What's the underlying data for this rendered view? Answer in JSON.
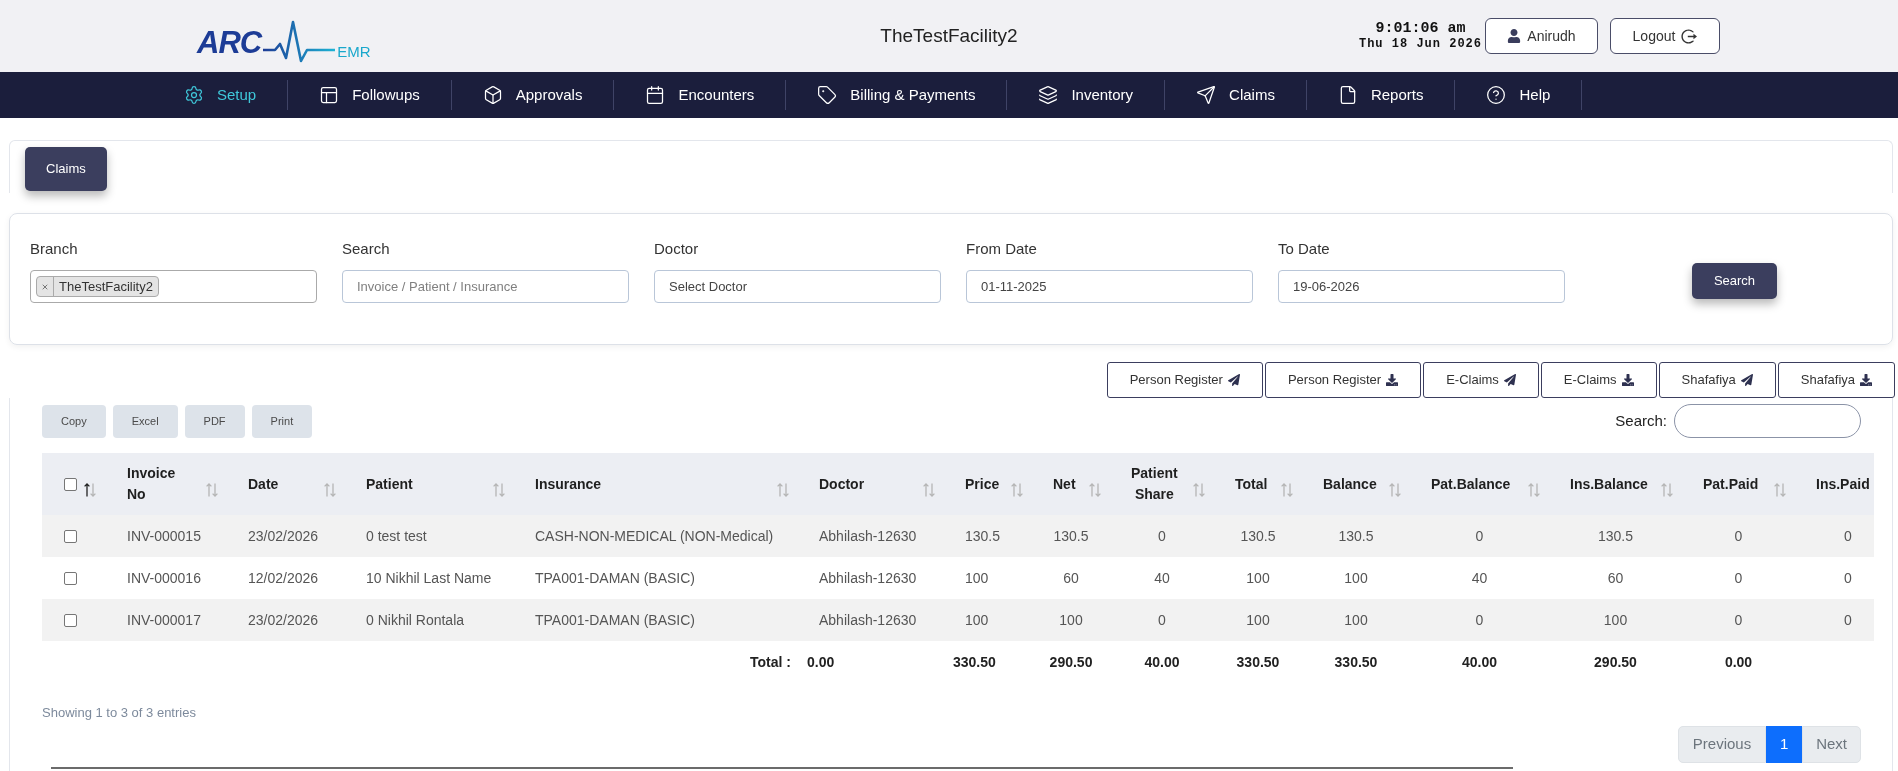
{
  "header": {
    "logo": {
      "brand": "ARC",
      "suffix": "EMR"
    },
    "title": "TheTestFacility2",
    "clock": {
      "time": "9:01:06 am",
      "date": "Thu 18 Jun 2026"
    },
    "user_button": "Anirudh",
    "logout_button": "Logout"
  },
  "nav": [
    {
      "label": "Setup",
      "selected": true
    },
    {
      "label": "Followups",
      "selected": false
    },
    {
      "label": "Approvals",
      "selected": false
    },
    {
      "label": "Encounters",
      "selected": false
    },
    {
      "label": "Billing & Payments",
      "selected": false
    },
    {
      "label": "Inventory",
      "selected": false
    },
    {
      "label": "Claims",
      "selected": false
    },
    {
      "label": "Reports",
      "selected": false
    },
    {
      "label": "Help",
      "selected": false
    }
  ],
  "page_tabs": [
    {
      "label": "Claims",
      "selected": true
    }
  ],
  "filters": [
    {
      "kind": "tags",
      "label": "Branch",
      "tags": [
        "TheTestFacility2"
      ]
    },
    {
      "kind": "text",
      "label": "Search",
      "placeholder": "Invoice / Patient / Insurance"
    },
    {
      "kind": "select",
      "label": "Doctor",
      "value": "Select Doctor"
    },
    {
      "kind": "date",
      "label": "From Date",
      "value": "01-11-2025"
    },
    {
      "kind": "date",
      "label": "To Date",
      "value": "19-06-2026"
    }
  ],
  "search_button": "Search",
  "export_buttons": [
    {
      "label": "Person Register",
      "kind": "send"
    },
    {
      "label": "Person Register",
      "kind": "download"
    },
    {
      "label": "E-Claims",
      "kind": "send"
    },
    {
      "label": "E-Claims",
      "kind": "download"
    },
    {
      "label": "Shafafiya",
      "kind": "send"
    },
    {
      "label": "Shafafiya",
      "kind": "download"
    }
  ],
  "table_tools": [
    "Copy",
    "Excel",
    "PDF",
    "Print"
  ],
  "table_search": {
    "label": "Search:"
  },
  "table": {
    "select_all": {
      "checked": false,
      "sorted": true
    },
    "columns": [
      {
        "label": "Invoice No",
        "sorted": false
      },
      {
        "label": "Date",
        "sorted": false
      },
      {
        "label": "Patient",
        "sorted": false
      },
      {
        "label": "Insurance",
        "sorted": false
      },
      {
        "label": "Doctor",
        "sorted": false
      },
      {
        "label": "Price",
        "sorted": false
      },
      {
        "label": "Net",
        "sorted": false
      },
      {
        "label": "Patient Share",
        "sorted": false
      },
      {
        "label": "Total",
        "sorted": false
      },
      {
        "label": "Balance",
        "sorted": false
      },
      {
        "label": "Pat.Balance",
        "sorted": false
      },
      {
        "label": "Ins.Balance",
        "sorted": false
      },
      {
        "label": "Pat.Paid",
        "sorted": false
      },
      {
        "label": "Ins.Paid"
      }
    ],
    "rows": [
      {
        "checked": false,
        "cells": [
          "INV-000015",
          "23/02/2026",
          "0 test test",
          "CASH-NON-MEDICAL (NON-Medical)",
          "Abhilash-12630",
          "130.5",
          "130.5",
          "0",
          "130.5",
          "130.5",
          "0",
          "130.5",
          "0",
          "0"
        ]
      },
      {
        "checked": false,
        "cells": [
          "INV-000016",
          "12/02/2026",
          "10 Nikhil Last Name",
          "TPA001-DAMAN (BASIC)",
          "Abhilash-12630",
          "100",
          "60",
          "40",
          "100",
          "100",
          "40",
          "60",
          "0",
          "0"
        ]
      },
      {
        "checked": false,
        "cells": [
          "INV-000017",
          "23/02/2026",
          "0 Nikhil Rontala",
          "TPA001-DAMAN (BASIC)",
          "Abhilash-12630",
          "100",
          "100",
          "0",
          "100",
          "100",
          "0",
          "100",
          "0",
          "0"
        ]
      }
    ],
    "footer": {
      "cells": [
        "",
        "",
        "",
        "Total :",
        "0.00",
        "330.50",
        "290.50",
        "40.00",
        "330.50",
        "330.50",
        "40.00",
        "290.50",
        "0.00"
      ]
    }
  },
  "pagination": {
    "info": "Showing 1 to 3 of 3 entries",
    "previous": {
      "label": "Previous",
      "disabled": true
    },
    "pages": [
      {
        "label": "1",
        "selected": true
      }
    ],
    "next": {
      "label": "Next",
      "disabled": true
    }
  }
}
